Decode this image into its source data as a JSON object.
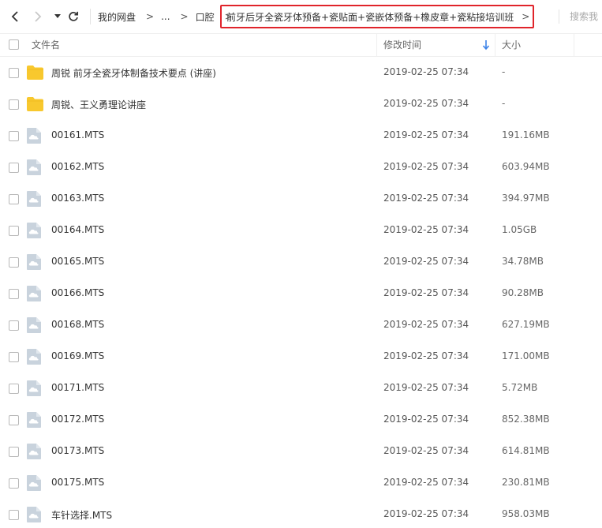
{
  "nav": {
    "back_icon": "chevron-left-icon",
    "forward_icon": "chevron-right-icon",
    "dropdown_icon": "caret-down-icon",
    "refresh_icon": "refresh-icon",
    "breadcrumb": [
      "我的网盘",
      "...",
      "口腔"
    ],
    "current_folder": "前牙后牙全瓷牙体预备+瓷贴面+瓷嵌体预备+橡皮章+瓷粘接培训班",
    "arrow": ">"
  },
  "search": {
    "placeholder": "搜索我"
  },
  "columns": {
    "name": "文件名",
    "modified": "修改时间",
    "size": "大小"
  },
  "colors": {
    "highlight_border": "#e0242b",
    "folder": "#f8c82e",
    "file_icon": "#c9d3dd",
    "sort_accent": "#3b82e8"
  },
  "files": [
    {
      "type": "folder",
      "icon": "folder-icon",
      "name": "周锐 前牙全瓷牙体制备技术要点 (讲座)",
      "modified": "2019-02-25 07:34",
      "size": "-"
    },
    {
      "type": "folder",
      "icon": "folder-icon",
      "name": "周锐、王义勇理论讲座",
      "modified": "2019-02-25 07:34",
      "size": "-"
    },
    {
      "type": "file",
      "icon": "video-file-icon",
      "name": "00161.MTS",
      "modified": "2019-02-25 07:34",
      "size": "191.16MB"
    },
    {
      "type": "file",
      "icon": "video-file-icon",
      "name": "00162.MTS",
      "modified": "2019-02-25 07:34",
      "size": "603.94MB"
    },
    {
      "type": "file",
      "icon": "video-file-icon",
      "name": "00163.MTS",
      "modified": "2019-02-25 07:34",
      "size": "394.97MB"
    },
    {
      "type": "file",
      "icon": "video-file-icon",
      "name": "00164.MTS",
      "modified": "2019-02-25 07:34",
      "size": "1.05GB"
    },
    {
      "type": "file",
      "icon": "video-file-icon",
      "name": "00165.MTS",
      "modified": "2019-02-25 07:34",
      "size": "34.78MB"
    },
    {
      "type": "file",
      "icon": "video-file-icon",
      "name": "00166.MTS",
      "modified": "2019-02-25 07:34",
      "size": "90.28MB"
    },
    {
      "type": "file",
      "icon": "video-file-icon",
      "name": "00168.MTS",
      "modified": "2019-02-25 07:34",
      "size": "627.19MB"
    },
    {
      "type": "file",
      "icon": "video-file-icon",
      "name": "00169.MTS",
      "modified": "2019-02-25 07:34",
      "size": "171.00MB"
    },
    {
      "type": "file",
      "icon": "video-file-icon",
      "name": "00171.MTS",
      "modified": "2019-02-25 07:34",
      "size": "5.72MB"
    },
    {
      "type": "file",
      "icon": "video-file-icon",
      "name": "00172.MTS",
      "modified": "2019-02-25 07:34",
      "size": "852.38MB"
    },
    {
      "type": "file",
      "icon": "video-file-icon",
      "name": "00173.MTS",
      "modified": "2019-02-25 07:34",
      "size": "614.81MB"
    },
    {
      "type": "file",
      "icon": "video-file-icon",
      "name": "00175.MTS",
      "modified": "2019-02-25 07:34",
      "size": "230.81MB"
    },
    {
      "type": "file",
      "icon": "video-file-icon",
      "name": "车针选择.MTS",
      "modified": "2019-02-25 07:34",
      "size": "958.03MB"
    }
  ]
}
